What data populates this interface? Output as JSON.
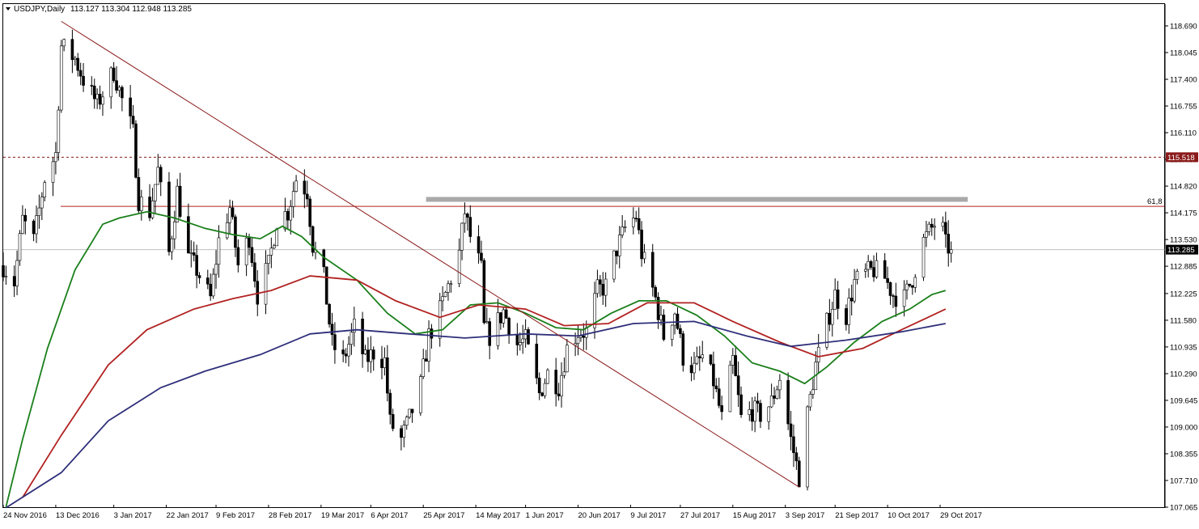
{
  "chart_data": {
    "type": "candlestick",
    "title": "USDJPY,Daily",
    "ohlc_header": "113.127 113.304 112.948 113.285",
    "ylim": [
      107.065,
      118.99
    ],
    "y_ticks": [
      "118.690",
      "118.045",
      "117.400",
      "116.755",
      "116.110",
      "115.465",
      "114.820",
      "114.175",
      "113.530",
      "112.885",
      "112.225",
      "111.580",
      "110.935",
      "110.290",
      "109.645",
      "109.000",
      "108.355",
      "107.710",
      "107.065"
    ],
    "x_ticks": [
      {
        "label": "24 Nov 2016",
        "date": "2016-11-24"
      },
      {
        "label": "13 Dec 2016",
        "date": "2016-12-13"
      },
      {
        "label": "3 Jan 2017",
        "date": "2017-01-03"
      },
      {
        "label": "22 Jan 2017",
        "date": "2017-01-22"
      },
      {
        "label": "9 Feb 2017",
        "date": "2017-02-09"
      },
      {
        "label": "28 Feb 2017",
        "date": "2017-02-28"
      },
      {
        "label": "19 Mar 2017",
        "date": "2017-03-19"
      },
      {
        "label": "6 Apr 2017",
        "date": "2017-04-06"
      },
      {
        "label": "25 Apr 2017",
        "date": "2017-04-25"
      },
      {
        "label": "14 May 2017",
        "date": "2017-05-14"
      },
      {
        "label": "1 Jun 2017",
        "date": "2017-06-01"
      },
      {
        "label": "20 Jun 2017",
        "date": "2017-06-20"
      },
      {
        "label": "9 Jul 2017",
        "date": "2017-07-09"
      },
      {
        "label": "27 Jul 2017",
        "date": "2017-07-27"
      },
      {
        "label": "15 Aug 2017",
        "date": "2017-08-15"
      },
      {
        "label": "3 Sep 2017",
        "date": "2017-09-03"
      },
      {
        "label": "21 Sep 2017",
        "date": "2017-09-21"
      },
      {
        "label": "10 Oct 2017",
        "date": "2017-10-10"
      },
      {
        "label": "29 Oct 2017",
        "date": "2017-10-29"
      }
    ],
    "horizontal_lines": [
      {
        "value": 115.518,
        "label": "115.518",
        "style": "dashed",
        "color": "#8b1a1a"
      },
      {
        "value": 114.33,
        "label": "61,8",
        "style": "solid",
        "color": "#b22222"
      },
      {
        "value": 113.285,
        "label": "113.285",
        "style": "solid",
        "color": "#c0c0c0"
      }
    ],
    "resistance_zone": {
      "from": "2017-04-26",
      "to": "2017-11-08",
      "value": 114.5,
      "color": "#a9a9a9"
    },
    "trendline": {
      "x1": "2016-12-15",
      "y1": 118.8,
      "x2": "2017-09-08",
      "y2": 107.55,
      "color": "#8b1a1a"
    },
    "moving_averages": [
      {
        "color": "#1a7f1a",
        "points": [
          [
            "2016-11-25",
            107.07
          ],
          [
            "2016-12-01",
            108.7
          ],
          [
            "2016-12-10",
            110.9
          ],
          [
            "2016-12-20",
            112.8
          ],
          [
            "2016-12-30",
            113.9
          ],
          [
            "2017-01-05",
            114.05
          ],
          [
            "2017-01-15",
            114.2
          ],
          [
            "2017-01-25",
            114.05
          ],
          [
            "2017-02-05",
            113.8
          ],
          [
            "2017-02-15",
            113.65
          ],
          [
            "2017-02-25",
            113.55
          ],
          [
            "2017-03-05",
            113.85
          ],
          [
            "2017-03-12",
            113.6
          ],
          [
            "2017-03-20",
            113.1
          ],
          [
            "2017-04-01",
            112.55
          ],
          [
            "2017-04-12",
            111.75
          ],
          [
            "2017-04-22",
            111.25
          ],
          [
            "2017-05-02",
            111.35
          ],
          [
            "2017-05-12",
            111.95
          ],
          [
            "2017-05-22",
            112.0
          ],
          [
            "2017-06-01",
            111.75
          ],
          [
            "2017-06-12",
            111.4
          ],
          [
            "2017-06-22",
            111.35
          ],
          [
            "2017-07-02",
            111.75
          ],
          [
            "2017-07-12",
            112.05
          ],
          [
            "2017-07-22",
            112.05
          ],
          [
            "2017-08-02",
            111.7
          ],
          [
            "2017-08-12",
            111.2
          ],
          [
            "2017-08-22",
            110.55
          ],
          [
            "2017-09-01",
            110.35
          ],
          [
            "2017-09-10",
            110.05
          ],
          [
            "2017-09-18",
            110.45
          ],
          [
            "2017-09-28",
            111.05
          ],
          [
            "2017-10-08",
            111.55
          ],
          [
            "2017-10-18",
            111.85
          ],
          [
            "2017-10-26",
            112.2
          ],
          [
            "2017-10-31",
            112.3
          ]
        ]
      },
      {
        "color": "#b22222",
        "points": [
          [
            "2016-12-01",
            107.3
          ],
          [
            "2016-12-15",
            108.8
          ],
          [
            "2017-01-01",
            110.5
          ],
          [
            "2017-01-15",
            111.35
          ],
          [
            "2017-02-01",
            111.85
          ],
          [
            "2017-02-15",
            112.1
          ],
          [
            "2017-03-01",
            112.3
          ],
          [
            "2017-03-15",
            112.65
          ],
          [
            "2017-04-01",
            112.55
          ],
          [
            "2017-04-15",
            112.05
          ],
          [
            "2017-05-01",
            111.65
          ],
          [
            "2017-05-15",
            111.95
          ],
          [
            "2017-06-01",
            111.85
          ],
          [
            "2017-06-15",
            111.45
          ],
          [
            "2017-07-01",
            111.5
          ],
          [
            "2017-07-15",
            112.0
          ],
          [
            "2017-08-01",
            112.0
          ],
          [
            "2017-08-15",
            111.55
          ],
          [
            "2017-09-01",
            111.05
          ],
          [
            "2017-09-15",
            110.7
          ],
          [
            "2017-10-01",
            110.9
          ],
          [
            "2017-10-15",
            111.35
          ],
          [
            "2017-10-31",
            111.85
          ]
        ]
      },
      {
        "color": "#2e2e7a",
        "points": [
          [
            "2016-11-25",
            107.05
          ],
          [
            "2016-12-15",
            107.9
          ],
          [
            "2017-01-01",
            109.15
          ],
          [
            "2017-01-20",
            109.95
          ],
          [
            "2017-02-05",
            110.35
          ],
          [
            "2017-02-25",
            110.75
          ],
          [
            "2017-03-15",
            111.25
          ],
          [
            "2017-04-01",
            111.35
          ],
          [
            "2017-04-20",
            111.25
          ],
          [
            "2017-05-10",
            111.15
          ],
          [
            "2017-06-01",
            111.25
          ],
          [
            "2017-06-20",
            111.2
          ],
          [
            "2017-07-10",
            111.5
          ],
          [
            "2017-08-01",
            111.55
          ],
          [
            "2017-08-20",
            111.2
          ],
          [
            "2017-09-05",
            110.95
          ],
          [
            "2017-09-25",
            111.1
          ],
          [
            "2017-10-15",
            111.3
          ],
          [
            "2017-10-31",
            111.5
          ]
        ]
      }
    ],
    "price_path": [
      [
        "2016-11-24",
        112.9
      ],
      [
        "2016-11-28",
        112.5
      ],
      [
        "2016-12-01",
        114.0
      ],
      [
        "2016-12-05",
        113.5
      ],
      [
        "2016-12-09",
        115.0
      ],
      [
        "2016-12-13",
        115.6
      ],
      [
        "2016-12-15",
        118.2
      ],
      [
        "2016-12-20",
        117.9
      ],
      [
        "2016-12-23",
        117.4
      ],
      [
        "2016-12-28",
        116.8
      ],
      [
        "2017-01-03",
        117.6
      ],
      [
        "2017-01-06",
        116.9
      ],
      [
        "2017-01-10",
        116.1
      ],
      [
        "2017-01-12",
        114.5
      ],
      [
        "2017-01-16",
        114.2
      ],
      [
        "2017-01-19",
        115.2
      ],
      [
        "2017-01-23",
        113.2
      ],
      [
        "2017-01-26",
        114.7
      ],
      [
        "2017-01-30",
        113.1
      ],
      [
        "2017-02-02",
        112.8
      ],
      [
        "2017-02-07",
        112.1
      ],
      [
        "2017-02-10",
        113.5
      ],
      [
        "2017-02-14",
        114.3
      ],
      [
        "2017-02-17",
        112.9
      ],
      [
        "2017-02-21",
        113.6
      ],
      [
        "2017-02-24",
        112.2
      ],
      [
        "2017-02-28",
        112.9
      ],
      [
        "2017-03-03",
        114.0
      ],
      [
        "2017-03-07",
        114.2
      ],
      [
        "2017-03-10",
        115.0
      ],
      [
        "2017-03-14",
        114.7
      ],
      [
        "2017-03-16",
        113.4
      ],
      [
        "2017-03-20",
        112.6
      ],
      [
        "2017-03-23",
        111.0
      ],
      [
        "2017-03-27",
        110.6
      ],
      [
        "2017-03-31",
        111.4
      ],
      [
        "2017-04-04",
        110.6
      ],
      [
        "2017-04-07",
        110.8
      ],
      [
        "2017-04-11",
        110.6
      ],
      [
        "2017-04-13",
        109.1
      ],
      [
        "2017-04-17",
        108.7
      ],
      [
        "2017-04-20",
        109.2
      ],
      [
        "2017-04-24",
        110.0
      ],
      [
        "2017-04-27",
        111.2
      ],
      [
        "2017-05-01",
        111.8
      ],
      [
        "2017-05-05",
        112.6
      ],
      [
        "2017-05-08",
        113.2
      ],
      [
        "2017-05-10",
        114.2
      ],
      [
        "2017-05-12",
        113.6
      ],
      [
        "2017-05-16",
        112.8
      ],
      [
        "2017-05-17",
        111.4
      ],
      [
        "2017-05-19",
        111.2
      ],
      [
        "2017-05-24",
        111.8
      ],
      [
        "2017-05-29",
        111.0
      ],
      [
        "2017-06-01",
        111.1
      ],
      [
        "2017-06-06",
        109.8
      ],
      [
        "2017-06-09",
        110.3
      ],
      [
        "2017-06-13",
        110.0
      ],
      [
        "2017-06-16",
        110.9
      ],
      [
        "2017-06-20",
        111.3
      ],
      [
        "2017-06-23",
        111.3
      ],
      [
        "2017-06-27",
        112.3
      ],
      [
        "2017-06-30",
        112.4
      ],
      [
        "2017-07-04",
        113.3
      ],
      [
        "2017-07-07",
        113.8
      ],
      [
        "2017-07-11",
        114.1
      ],
      [
        "2017-07-13",
        113.2
      ],
      [
        "2017-07-18",
        112.1
      ],
      [
        "2017-07-21",
        111.2
      ],
      [
        "2017-07-25",
        111.8
      ],
      [
        "2017-07-28",
        110.7
      ],
      [
        "2017-08-01",
        110.4
      ],
      [
        "2017-08-04",
        110.7
      ],
      [
        "2017-08-08",
        110.1
      ],
      [
        "2017-08-11",
        109.2
      ],
      [
        "2017-08-15",
        110.6
      ],
      [
        "2017-08-18",
        109.2
      ],
      [
        "2017-08-22",
        109.4
      ],
      [
        "2017-08-25",
        109.3
      ],
      [
        "2017-08-29",
        109.6
      ],
      [
        "2017-09-01",
        110.2
      ],
      [
        "2017-09-05",
        108.7
      ],
      [
        "2017-09-08",
        107.8
      ],
      [
        "2017-09-11",
        109.3
      ],
      [
        "2017-09-14",
        110.5
      ],
      [
        "2017-09-18",
        111.5
      ],
      [
        "2017-09-21",
        112.2
      ],
      [
        "2017-09-25",
        111.7
      ],
      [
        "2017-09-28",
        112.5
      ],
      [
        "2017-10-02",
        112.7
      ],
      [
        "2017-10-05",
        112.8
      ],
      [
        "2017-10-09",
        112.6
      ],
      [
        "2017-10-12",
        112.2
      ],
      [
        "2017-10-16",
        112.1
      ],
      [
        "2017-10-19",
        112.6
      ],
      [
        "2017-10-23",
        113.5
      ],
      [
        "2017-10-26",
        113.8
      ],
      [
        "2017-10-29",
        114.1
      ],
      [
        "2017-10-31",
        113.4
      ],
      [
        "2017-11-02",
        113.285
      ]
    ]
  }
}
